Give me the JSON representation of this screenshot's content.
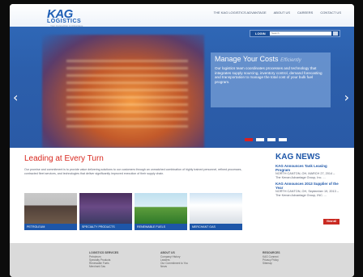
{
  "header": {
    "logo_main": "KAG",
    "logo_sub": "LOGISTICS",
    "logo_tagline": "Your Connection to Advantage",
    "nav": [
      "THE KAG LOGISTICS ADVANTAGE",
      "ABOUT US",
      "CAREERS",
      "CONTACT US"
    ]
  },
  "hero": {
    "login_label": "LOGIN",
    "search_placeholder": "Search",
    "callout_title": "Manage Your Costs",
    "callout_title_accent": "Efficiently",
    "callout_body": "Our logistics team coordinates processes and technology that integrates supply sourcing, inventory control, demand forecasting and transportation to manage the total cost of your bulk fuel program.",
    "arrow_left": "‹",
    "arrow_right": "›",
    "slides": 4,
    "active_slide": 1
  },
  "main": {
    "title": "Leading at Every Turn",
    "intro": "Our promise and commitment is to provide value delivering solutions to our customers through an unmatched combination of highly trained personnel, refined processes, contracted fleet services, and technologies that deliver significantly improved execution of their supply chain.",
    "tiles": [
      "PETROLEUM",
      "SPECIALTY PRODUCTS",
      "RENEWABLE FUELS",
      "MERCHANT GAS"
    ]
  },
  "news": {
    "title": "KAG NEWS",
    "items": [
      {
        "headline": "KAG Announces Tank Leasing Program",
        "text": "NORTH CANTON, OH, MARCH 27, 2014 – The Kenan Advantage Group, Inc. ..."
      },
      {
        "headline": "KAG Announces 2013 Supplier of the Year",
        "text": "NORTH CANTON, OH, September 19, 2013 – The Kenan Advantage Group, INC. ..."
      }
    ],
    "view_all": "View all"
  },
  "footer": {
    "col1": {
      "title": "LOGISTICS SERVICES",
      "items": [
        "Petroleum",
        "Specialty Products",
        "Renewable Fuels",
        "Merchant Gas"
      ]
    },
    "col2": {
      "title": "ABOUT US",
      "items": [
        "Company History",
        "Leaders",
        "Our Commitment to You",
        "News"
      ]
    },
    "col3": {
      "title": "RESOURCES",
      "items": [
        "KAG Connect",
        "Privacy Policy",
        "Sitemap"
      ]
    }
  },
  "colors": {
    "brand_blue": "#1d56a8",
    "accent_red": "#d8281f",
    "hero_blue": "#2c5fac",
    "footer_gray": "#dadada"
  }
}
